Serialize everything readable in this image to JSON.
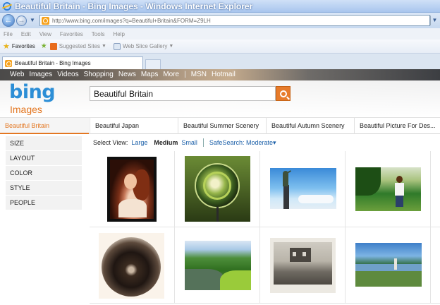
{
  "window": {
    "title": "Beautiful Britain - Bing Images - Windows Internet Explorer",
    "address_url": "http://www.bing.com/images?q=Beautiful+Britain&FORM=Z9LH"
  },
  "menu": [
    "File",
    "Edit",
    "View",
    "Favorites",
    "Tools",
    "Help"
  ],
  "favorites_bar": {
    "favorites_label": "Favorites",
    "suggested_sites": "Suggested Sites",
    "web_slice_gallery": "Web Slice Gallery"
  },
  "tab": {
    "title": "Beautiful Britain - Bing Images"
  },
  "bing": {
    "nav": [
      "Web",
      "Images",
      "Videos",
      "Shopping",
      "News",
      "Maps",
      "More"
    ],
    "nav_sep": "|",
    "nav_right": [
      "MSN",
      "Hotmail"
    ],
    "logo": "bing",
    "section": "Images",
    "search_query": "Beautiful Britain"
  },
  "related_searches": [
    "Beautiful Britain",
    "Beautiful Japan",
    "Beautiful Summer Scenery",
    "Beautiful Autumn Scenery",
    "Beautiful Picture For Des..."
  ],
  "filters": [
    "SIZE",
    "LAYOUT",
    "COLOR",
    "STYLE",
    "PEOPLE"
  ],
  "view_options": {
    "label": "Select View:",
    "large": "Large",
    "medium": "Medium",
    "small": "Small",
    "safesearch": "SafeSearch: Moderate▾"
  },
  "colors": {
    "bing_blue": "#2c8ed6",
    "accent_orange": "#e37722",
    "link_blue": "#1a5fa8"
  },
  "icons": {
    "back": "back-arrow-icon",
    "forward": "forward-arrow-icon",
    "search": "magnifier-icon",
    "favorites": "star-icon"
  }
}
